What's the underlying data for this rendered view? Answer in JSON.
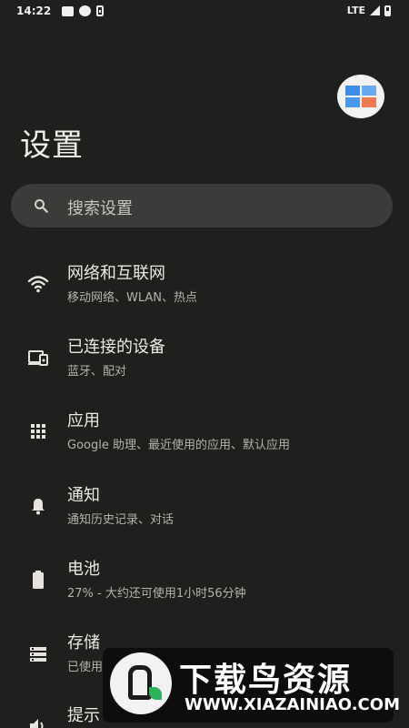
{
  "status_bar": {
    "time": "14:22",
    "network": "LTE",
    "icons": [
      "notification-square-icon",
      "notification-circle-icon",
      "download-icon",
      "signal-icon",
      "battery-icon"
    ]
  },
  "header": {
    "title": "设置",
    "avatar_icon": "windows-logo-icon"
  },
  "search": {
    "placeholder": "搜索设置",
    "icon": "search-icon"
  },
  "settings": [
    {
      "label": "网络和互联网",
      "sub": "移动网络、WLAN、热点",
      "icon": "wifi-icon"
    },
    {
      "label": "已连接的设备",
      "sub": "蓝牙、配对",
      "icon": "devices-icon"
    },
    {
      "label": "应用",
      "sub": "Google 助理、最近使用的应用、默认应用",
      "icon": "apps-grid-icon"
    },
    {
      "label": "通知",
      "sub": "通知历史记录、对话",
      "icon": "bell-icon"
    },
    {
      "label": "电池",
      "sub": "27% - 大约还可使用1小时56分钟",
      "icon": "battery-icon"
    },
    {
      "label": "存储",
      "sub": "已使用",
      "icon": "storage-icon"
    },
    {
      "label": "提示",
      "sub": "",
      "icon": "sound-icon"
    }
  ],
  "watermark": {
    "title": "下载鸟资源",
    "url": "WWW.XIAZAINIAO.COM"
  },
  "colors": {
    "background": "#1f201e",
    "search_bg": "#3b3c39",
    "text_primary": "#ece9e2",
    "text_secondary": "#b5b2aa"
  }
}
